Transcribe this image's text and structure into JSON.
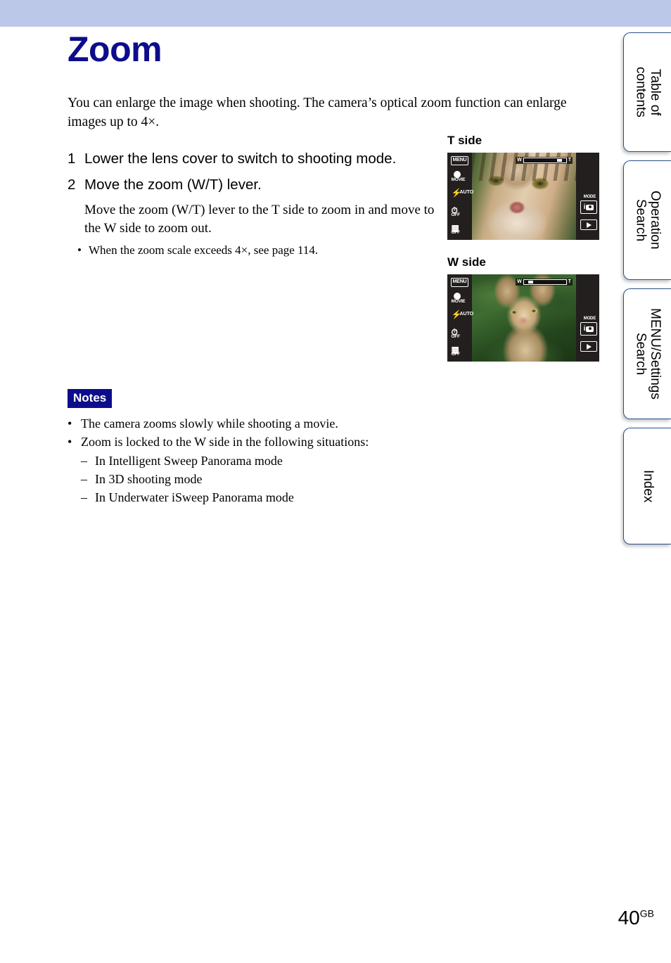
{
  "page": {
    "title": "Zoom",
    "number": "40",
    "number_suffix": "GB",
    "band_color": "#bcc8e8",
    "title_color": "#0d0d8c"
  },
  "intro": "You can enlarge the image when shooting. The camera’s optical zoom function can enlarge images up to 4×.",
  "steps": [
    {
      "num": "1",
      "text": "Lower the lens cover to switch to shooting mode.",
      "body": "",
      "bullets": []
    },
    {
      "num": "2",
      "text": "Move the zoom (W/T) lever.",
      "body": "Move the zoom (W/T) lever to the T side to zoom in and move to the W side to zoom out.",
      "bullets": [
        "When the zoom scale exceeds 4×, see page 114."
      ]
    }
  ],
  "figures": [
    {
      "label": "T side",
      "zoom_bar": {
        "left_label": "W",
        "right_label": "T",
        "knob_position_pct": 78
      },
      "screen": {
        "menu_label": "MENU",
        "mode_label": "MODE",
        "icons": [
          {
            "name": "movie-icon",
            "sub": "MOVIE",
            "side": ""
          },
          {
            "name": "flash-icon",
            "sub": "",
            "side": "AUTO"
          },
          {
            "name": "self-timer-icon",
            "sub": "OFF",
            "side": ""
          },
          {
            "name": "burst-icon",
            "sub": "OFF",
            "side": ""
          }
        ],
        "mode_button": "i",
        "playback_button": "▶"
      }
    },
    {
      "label": "W side",
      "zoom_bar": {
        "left_label": "W",
        "right_label": "T",
        "knob_position_pct": 10
      },
      "screen": {
        "menu_label": "MENU",
        "mode_label": "MODE",
        "icons": [
          {
            "name": "movie-icon",
            "sub": "MOVIE",
            "side": ""
          },
          {
            "name": "flash-icon",
            "sub": "",
            "side": "AUTO"
          },
          {
            "name": "self-timer-icon",
            "sub": "OFF",
            "side": ""
          },
          {
            "name": "burst-icon",
            "sub": "OFF",
            "side": ""
          }
        ],
        "mode_button": "i",
        "playback_button": "▶"
      }
    }
  ],
  "notes": {
    "badge": "Notes",
    "badge_bg": "#0d0d8c",
    "items": [
      {
        "text": "The camera zooms slowly while shooting a movie.",
        "sub": []
      },
      {
        "text": "Zoom is locked to the W side in the following situations:",
        "sub": [
          "In Intelligent Sweep Panorama mode",
          "In 3D shooting mode",
          "In Underwater iSweep Panorama mode"
        ]
      }
    ]
  },
  "tabs": [
    {
      "label": "Table of\ncontents"
    },
    {
      "label": "Operation\nSearch"
    },
    {
      "label": "MENU/Settings\nSearch"
    },
    {
      "label": "Index"
    }
  ]
}
